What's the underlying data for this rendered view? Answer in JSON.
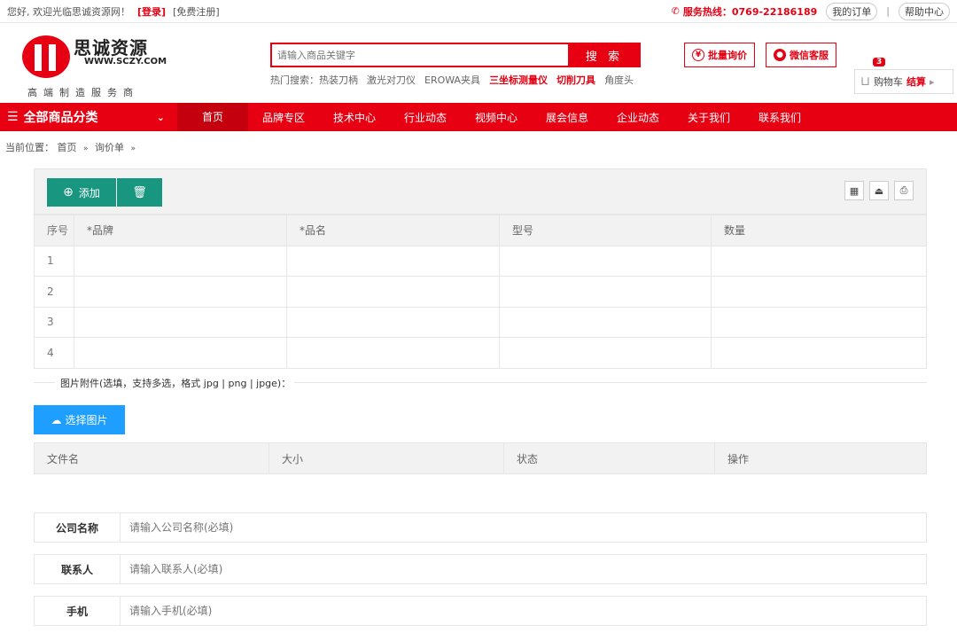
{
  "topbar": {
    "welcome": "您好, 欢迎光临思诚资源网！",
    "login": "[登录]",
    "register": "[免费注册]",
    "hotline": "服务热线：0769-22186189",
    "orders": "我的订单",
    "separator": "|",
    "help": "帮助中心"
  },
  "logo": {
    "name": "思诚资源",
    "url": "WWW.SCZY.COM",
    "slogan": "高端制造服务商"
  },
  "search": {
    "placeholder": "请输入商品关键字",
    "button": "搜 索",
    "hot_label": "热门搜索：",
    "hot_items": [
      "热装刀柄",
      "激光对刀仪",
      "EROWA夹具",
      "三坐标测量仪",
      "切削刀具",
      "角度头"
    ]
  },
  "header_buttons": {
    "bulk_inquiry": "批量询价",
    "bulk_icon": "¥",
    "wechat": "微信客服"
  },
  "cart": {
    "count": "3",
    "label": "购物车",
    "settle": "结算",
    "arrow": "▸"
  },
  "nav": {
    "all_categories": "全部商品分类",
    "items": [
      "首页",
      "品牌专区",
      "技术中心",
      "行业动态",
      "视频中心",
      "展会信息",
      "企业动态",
      "关于我们",
      "联系我们"
    ]
  },
  "breadcrumb": {
    "label": "当前位置：",
    "items": [
      "首页",
      "询价单"
    ],
    "sep": "»"
  },
  "toolbar": {
    "add": "添加",
    "add_icon": "⊕",
    "delete_icon": "🗑",
    "tool_icons": [
      "▦",
      "⏏",
      "⎙"
    ]
  },
  "table": {
    "headers": [
      "序号",
      "*品牌",
      "*品名",
      "型号",
      "数量"
    ],
    "rows": [
      "1",
      "2",
      "3",
      "4"
    ]
  },
  "attachments": {
    "title": "图片附件(选填，支持多选，格式 jpg | png | jpge)：",
    "pick_button": "选择图片",
    "pick_icon": "☁",
    "headers": [
      "文件名",
      "大小",
      "状态",
      "操作"
    ]
  },
  "form": {
    "company_label": "公司名称",
    "company_placeholder": "请输入公司名称(必填)",
    "contact_label": "联系人",
    "contact_placeholder": "请输入联系人(必填)",
    "phone_label": "手机",
    "phone_placeholder": "请输入手机(必填)"
  }
}
